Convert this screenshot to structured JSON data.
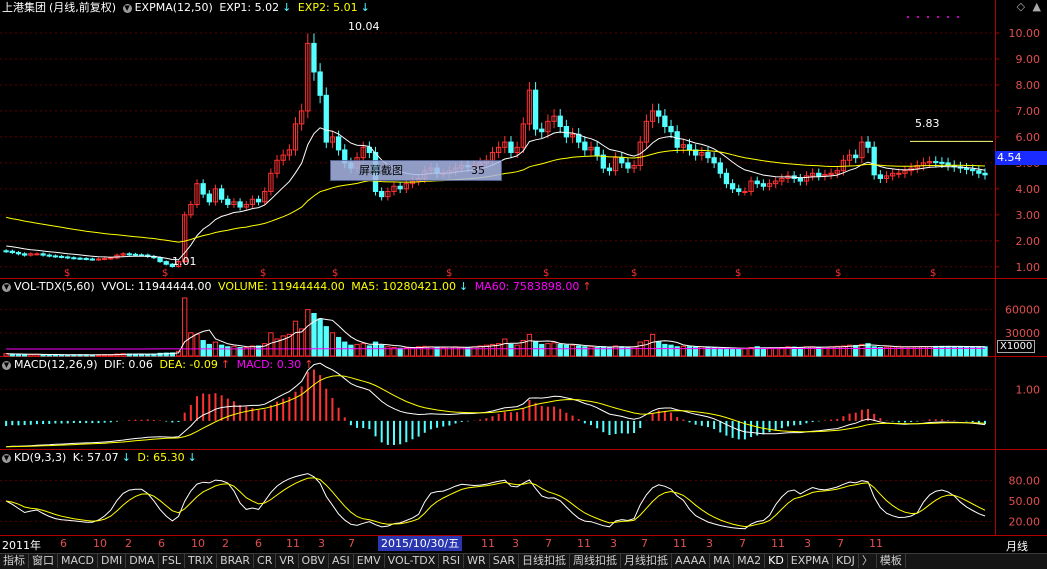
{
  "stock": {
    "name": "上港集团",
    "period_desc": "(月线,前复权)"
  },
  "panels": {
    "price": {
      "indicator": "EXPMA(12,50)",
      "exp1": "EXP1: 5.02",
      "exp2": "EXP2: 5.01",
      "high_label": "10.04",
      "low_label": "1.01",
      "recent_high_label": "5.83",
      "current_price_tag": "4.54",
      "ticks": [
        "10.00",
        "9.00",
        "8.00",
        "7.00",
        "6.00",
        "5.00",
        "4.00",
        "3.00",
        "2.00",
        "1.00"
      ]
    },
    "volume": {
      "indicator": "VOL-TDX(5,60)",
      "vvol": "VVOL: 11944444.00",
      "volume": "VOLUME: 11944444.00",
      "ma5": "MA5: 10280421.00",
      "ma60": "MA60: 7583898.00",
      "ticks": [
        "60000",
        "30000"
      ],
      "unit": "X1000"
    },
    "macd": {
      "indicator": "MACD(12,26,9)",
      "dif": "DIF: 0.06",
      "dea": "DEA: -0.09",
      "macd": "MACD: 0.30",
      "ticks": [
        "1.00"
      ]
    },
    "kd": {
      "indicator": "KD(9,3,3)",
      "k": "K: 57.07",
      "d": "D: 65.30",
      "ticks": [
        "80.00",
        "50.00",
        "20.00"
      ]
    }
  },
  "tooltip": {
    "label": "屏幕截图",
    "value": "35"
  },
  "time_axis": {
    "labels": [
      "2011年",
      "6",
      "10",
      "2",
      "6",
      "10",
      "2",
      "6",
      "11",
      "3",
      "7",
      "11",
      "3",
      "7",
      "11",
      "3",
      "7",
      "11",
      "3",
      "7",
      "11",
      "3",
      "7",
      "11",
      "3",
      "7",
      "11"
    ],
    "highlight": "2015/10/30/五"
  },
  "period": "月线",
  "tabs": [
    "指标",
    "窗口",
    "MACD",
    "DMI",
    "DMA",
    "FSL",
    "TRIX",
    "BRAR",
    "CR",
    "VR",
    "OBV",
    "ASI",
    "EMV",
    "VOL-TDX",
    "RSI",
    "WR",
    "SAR",
    "日线扣抵",
    "周线扣抵",
    "月线扣抵",
    "AAAA",
    "MA",
    "MA2",
    "KD",
    "EXPMA",
    "KDJ",
    "〉",
    "模板"
  ],
  "colors": {
    "up": "#ff3232",
    "down": "#54ffff",
    "line1": "#ffffff",
    "line2": "#ffff00",
    "macd_line": "#ff00ff",
    "axis": "#b00000"
  },
  "chart_data": [
    {
      "type": "candlestick",
      "title": "上港集团 (月线,前复权)",
      "y_range": [
        0.8,
        10.5
      ],
      "x": [
        0,
        1,
        2,
        3,
        4,
        5,
        6,
        7,
        8,
        9,
        10,
        11,
        12,
        13,
        14,
        15,
        16,
        17,
        18,
        19,
        20,
        21,
        22,
        23,
        24,
        25,
        26,
        27,
        28,
        29,
        30,
        31,
        32,
        33,
        34,
        35,
        36,
        37,
        38,
        39,
        40,
        41,
        42,
        43,
        44,
        45,
        46,
        47,
        48,
        49,
        50,
        51,
        52,
        53,
        54,
        55,
        56,
        57,
        58,
        59,
        60,
        61,
        62,
        63,
        64,
        65,
        66,
        67,
        68,
        69,
        70,
        71,
        72,
        73,
        74,
        75,
        76,
        77,
        78,
        79,
        80,
        81,
        82,
        83,
        84,
        85,
        86,
        87,
        88,
        89,
        90,
        91,
        92,
        93,
        94,
        95,
        96,
        97,
        98,
        99,
        100,
        101,
        102,
        103,
        104,
        105,
        106,
        107,
        108,
        109,
        110,
        111,
        112,
        113,
        114,
        115,
        116,
        117,
        118,
        119,
        120,
        121,
        122,
        123,
        124,
        125,
        126,
        127,
        128,
        129,
        130,
        131,
        132,
        133,
        134,
        135,
        136,
        137,
        138,
        139,
        140,
        141,
        142,
        143,
        144,
        145,
        146,
        147,
        148,
        149,
        150,
        151,
        152,
        153,
        154,
        155,
        156,
        157,
        158,
        159
      ],
      "close": [
        1.6,
        1.55,
        1.5,
        1.45,
        1.5,
        1.5,
        1.45,
        1.42,
        1.4,
        1.38,
        1.35,
        1.33,
        1.32,
        1.3,
        1.28,
        1.3,
        1.32,
        1.34,
        1.45,
        1.5,
        1.48,
        1.46,
        1.45,
        1.4,
        1.35,
        1.2,
        1.1,
        1.01,
        1.2,
        3.0,
        3.4,
        4.2,
        3.8,
        3.5,
        4.0,
        3.6,
        3.4,
        3.5,
        3.3,
        3.4,
        3.6,
        3.5,
        3.9,
        4.6,
        5.1,
        5.3,
        5.5,
        6.5,
        7.0,
        9.6,
        8.5,
        7.6,
        5.8,
        6.0,
        5.5,
        5.0,
        4.8,
        5.2,
        5.6,
        5.4,
        3.9,
        3.7,
        3.9,
        4.1,
        4.0,
        4.2,
        4.3,
        4.4,
        4.7,
        4.8,
        4.6,
        4.6,
        4.7,
        4.8,
        4.9,
        4.85,
        4.9,
        5.0,
        5.1,
        5.4,
        5.6,
        5.8,
        5.4,
        5.6,
        6.5,
        7.8,
        6.3,
        6.2,
        6.6,
        6.8,
        6.4,
        6.0,
        6.1,
        5.8,
        5.5,
        5.6,
        5.3,
        4.8,
        4.7,
        5.2,
        5.0,
        4.8,
        4.9,
        5.8,
        6.6,
        7.0,
        6.8,
        6.4,
        6.2,
        5.6,
        5.7,
        5.5,
        5.3,
        5.4,
        5.2,
        5.0,
        4.6,
        4.2,
        4.0,
        3.9,
        3.9,
        4.3,
        4.2,
        4.1,
        4.2,
        4.3,
        4.4,
        4.5,
        4.4,
        4.3,
        4.5,
        4.6,
        4.5,
        4.55,
        4.6,
        4.7,
        5.1,
        5.3,
        5.2,
        5.8,
        5.6,
        4.54,
        4.4,
        4.5,
        4.6,
        4.6,
        4.7,
        4.8,
        4.9,
        5.0,
        5.05,
        5.02,
        5.0,
        4.9,
        4.85,
        4.8,
        4.75,
        4.7,
        4.6,
        4.54
      ],
      "exp1": [
        1.8,
        1.77,
        1.73,
        1.69,
        1.66,
        1.64,
        1.61,
        1.58,
        1.56,
        1.53,
        1.5,
        1.48,
        1.46,
        1.43,
        1.41,
        1.39,
        1.38,
        1.37,
        1.38,
        1.39,
        1.4,
        1.41,
        1.41,
        1.41,
        1.4,
        1.37,
        1.33,
        1.28,
        1.27,
        1.54,
        1.83,
        2.2,
        2.45,
        2.61,
        2.82,
        2.94,
        3.01,
        3.09,
        3.12,
        3.17,
        3.24,
        3.28,
        3.38,
        3.6,
        3.83,
        4.06,
        4.28,
        4.62,
        4.99,
        5.7,
        6.13,
        6.35,
        6.26,
        6.22,
        6.11,
        5.94,
        5.76,
        5.68,
        5.67,
        5.63,
        5.37,
        5.11,
        4.92,
        4.79,
        4.67,
        4.6,
        4.56,
        4.54,
        4.57,
        4.6,
        4.6,
        4.6,
        4.61,
        4.64,
        4.68,
        4.7,
        4.73,
        4.77,
        4.83,
        4.92,
        5.03,
        5.15,
        5.2,
        5.27,
        5.46,
        5.82,
        5.89,
        5.93,
        6.03,
        6.15,
        6.19,
        6.16,
        6.15,
        6.09,
        5.99,
        5.93,
        5.83,
        5.67,
        5.52,
        5.47,
        5.41,
        5.32,
        5.26,
        5.35,
        5.54,
        5.77,
        5.93,
        5.99,
        6.02,
        5.95,
        5.91,
        5.84,
        5.76,
        5.71,
        5.64,
        5.54,
        5.39,
        5.21,
        5.03,
        4.86,
        4.73,
        4.67,
        4.6,
        4.53,
        4.5,
        4.47,
        4.46,
        4.46,
        4.45,
        4.43,
        4.44,
        4.46,
        4.47,
        4.48,
        4.5,
        4.53,
        4.62,
        4.72,
        4.79,
        4.93,
        5.03,
        4.95,
        4.86,
        4.8,
        4.77,
        4.74,
        4.73,
        4.74,
        4.76,
        4.79,
        4.83,
        4.84,
        4.86,
        4.85,
        4.85,
        4.84,
        4.82,
        4.8,
        4.76,
        4.72
      ],
      "exp2": [
        2.9,
        2.85,
        2.81,
        2.76,
        2.72,
        2.68,
        2.64,
        2.6,
        2.56,
        2.52,
        2.48,
        2.44,
        2.41,
        2.37,
        2.34,
        2.31,
        2.28,
        2.25,
        2.23,
        2.21,
        2.18,
        2.16,
        2.14,
        2.11,
        2.09,
        2.05,
        2.02,
        1.98,
        1.95,
        1.99,
        2.05,
        2.13,
        2.2,
        2.25,
        2.32,
        2.37,
        2.41,
        2.46,
        2.5,
        2.53,
        2.58,
        2.62,
        2.67,
        2.75,
        2.84,
        2.93,
        3.03,
        3.16,
        3.3,
        3.54,
        3.73,
        3.89,
        3.96,
        4.04,
        4.1,
        4.14,
        4.17,
        4.21,
        4.27,
        4.32,
        4.3,
        4.28,
        4.27,
        4.27,
        4.26,
        4.26,
        4.26,
        4.27,
        4.29,
        4.3,
        4.31,
        4.32,
        4.34,
        4.35,
        4.37,
        4.39,
        4.41,
        4.43,
        4.46,
        4.5,
        4.54,
        4.59,
        4.62,
        4.66,
        4.73,
        4.85,
        4.91,
        4.96,
        5.03,
        5.1,
        5.15,
        5.18,
        5.22,
        5.24,
        5.25,
        5.26,
        5.27,
        5.25,
        5.23,
        5.23,
        5.22,
        5.2,
        5.19,
        5.22,
        5.27,
        5.34,
        5.4,
        5.44,
        5.47,
        5.48,
        5.49,
        5.49,
        5.48,
        5.48,
        5.47,
        5.45,
        5.42,
        5.37,
        5.31,
        5.25,
        5.2,
        5.16,
        5.12,
        5.08,
        5.05,
        5.02,
        4.99,
        4.97,
        4.95,
        4.93,
        4.91,
        4.9,
        4.89,
        4.87,
        4.86,
        4.86,
        4.87,
        4.88,
        4.89,
        4.92,
        4.95,
        4.93,
        4.91,
        4.89,
        4.88,
        4.87,
        4.87,
        4.87,
        4.88,
        4.89,
        4.9,
        4.9,
        4.91,
        4.91,
        4.91,
        4.91,
        4.9,
        4.9,
        4.89,
        4.88
      ]
    },
    {
      "type": "bar",
      "title": "VOL-TDX(5,60)",
      "y_range": [
        0,
        75000
      ],
      "values_k": [
        3000,
        2500,
        2200,
        2000,
        2100,
        2200,
        1800,
        1700,
        1600,
        1500,
        1400,
        1500,
        1600,
        1500,
        1400,
        1500,
        1700,
        1800,
        2500,
        3000,
        2600,
        2400,
        2200,
        2300,
        2600,
        3500,
        3800,
        4000,
        6000,
        75000,
        30000,
        28000,
        20000,
        15000,
        18000,
        14000,
        12000,
        12500,
        11000,
        11000,
        13000,
        13000,
        16000,
        30000,
        22000,
        26000,
        28000,
        45000,
        35000,
        60000,
        55000,
        48000,
        38000,
        30000,
        24000,
        18000,
        14000,
        15000,
        16000,
        13000,
        18000,
        14000,
        12000,
        11000,
        10000,
        10500,
        11000,
        12000,
        12500,
        12000,
        11000,
        11000,
        11500,
        12000,
        11500,
        11000,
        12000,
        13000,
        14000,
        15000,
        16000,
        22000,
        15000,
        14000,
        20000,
        28000,
        18000,
        15000,
        16000,
        17000,
        15000,
        14000,
        14000,
        13000,
        12000,
        12000,
        11000,
        12000,
        11000,
        13000,
        12000,
        11000,
        12000,
        18000,
        20000,
        28000,
        18000,
        15000,
        14000,
        12000,
        12500,
        12000,
        11500,
        12000,
        11000,
        11000,
        10000,
        10500,
        10000,
        9500,
        9500,
        11000,
        12000,
        10500,
        10000,
        10000,
        11000,
        12000,
        11500,
        11000,
        12000,
        12000,
        11000,
        11500,
        12000,
        12500,
        13000,
        14000,
        13500,
        15000,
        16000,
        11944,
        11000,
        11500,
        12000,
        12500,
        12000,
        11800,
        12000,
        12200,
        12300,
        12400,
        12500,
        12400,
        12300,
        12200,
        12100,
        12000,
        11950,
        11944
      ]
    },
    {
      "type": "line",
      "title": "MACD(12,26,9)",
      "y_range": [
        -0.9,
        1.5
      ],
      "note": "DIF/DEA lines with histogram"
    },
    {
      "type": "line",
      "title": "KD(9,3,3)",
      "y_range": [
        0,
        100
      ],
      "note": "K and D oscillator lines"
    }
  ]
}
